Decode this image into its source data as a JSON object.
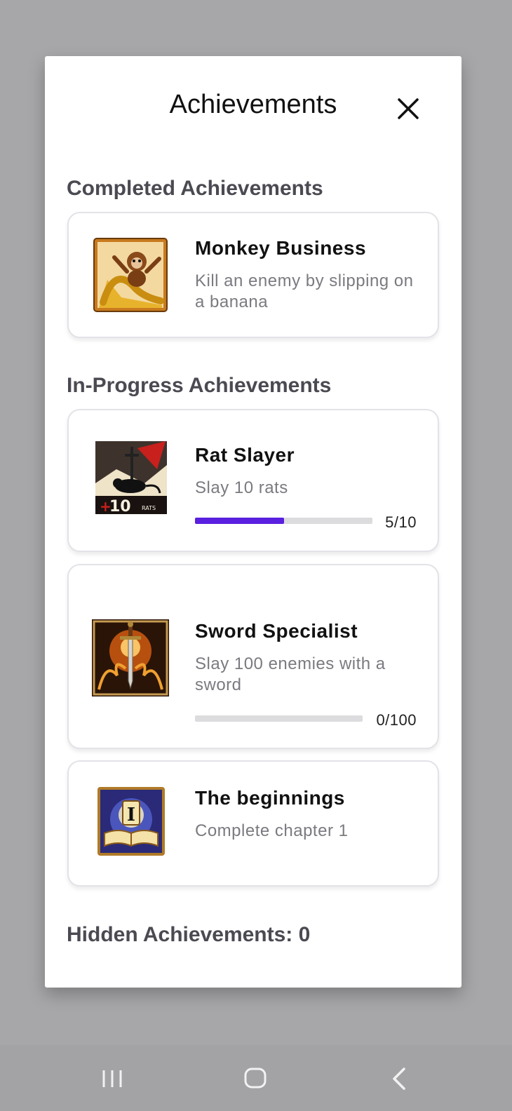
{
  "dialog": {
    "title": "Achievements",
    "close_icon": "close-icon"
  },
  "sections": {
    "completed_heading": "Completed Achievements",
    "in_progress_heading": "In-Progress Achievements",
    "hidden_label": "Hidden Achievements: 0"
  },
  "completed": [
    {
      "title": "Monkey Business",
      "description": "Kill an enemy by slipping on a banana",
      "icon": "monkey-banana-icon"
    }
  ],
  "in_progress": [
    {
      "title": "Rat Slayer",
      "description": "Slay 10 rats",
      "progress_text": "5/10",
      "progress": 0.5,
      "icon": "rat-slayer-icon"
    },
    {
      "title": "Sword Specialist",
      "description": "Slay 100 enemies with a sword",
      "progress_text": "0/100",
      "progress": 0.0,
      "icon": "sword-icon"
    },
    {
      "title": "The beginnings",
      "description": "Complete chapter 1",
      "icon": "chapter-book-icon"
    }
  ],
  "nav_bar": {
    "recents_icon": "recents-icon",
    "home_icon": "home-icon",
    "back_icon": "back-icon"
  },
  "colors": {
    "progress_fill": "#5a20e0",
    "progress_track": "#dcdcdf"
  }
}
